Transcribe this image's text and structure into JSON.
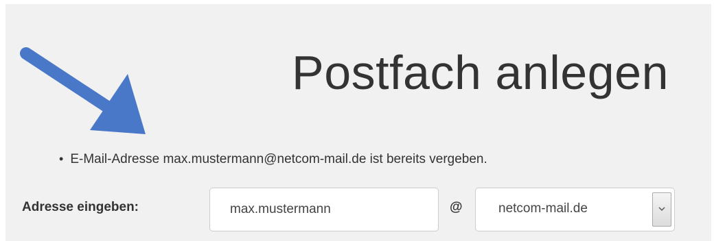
{
  "header": {
    "title": "Postfach anlegen"
  },
  "errors": {
    "items": [
      "E-Mail-Adresse max.mustermann@netcom-mail.de ist bereits vergeben."
    ]
  },
  "form": {
    "label": "Adresse eingeben:",
    "address_value": "max.mustermann",
    "at_symbol": "@",
    "domain_selected": "netcom-mail.de"
  },
  "annotation": {
    "arrow_color": "#4a78c8",
    "arrow_icon": "annotation-arrow-icon"
  },
  "colors": {
    "panel_background": "#f1f1f1",
    "text": "#333333",
    "input_border": "#cccccc"
  }
}
